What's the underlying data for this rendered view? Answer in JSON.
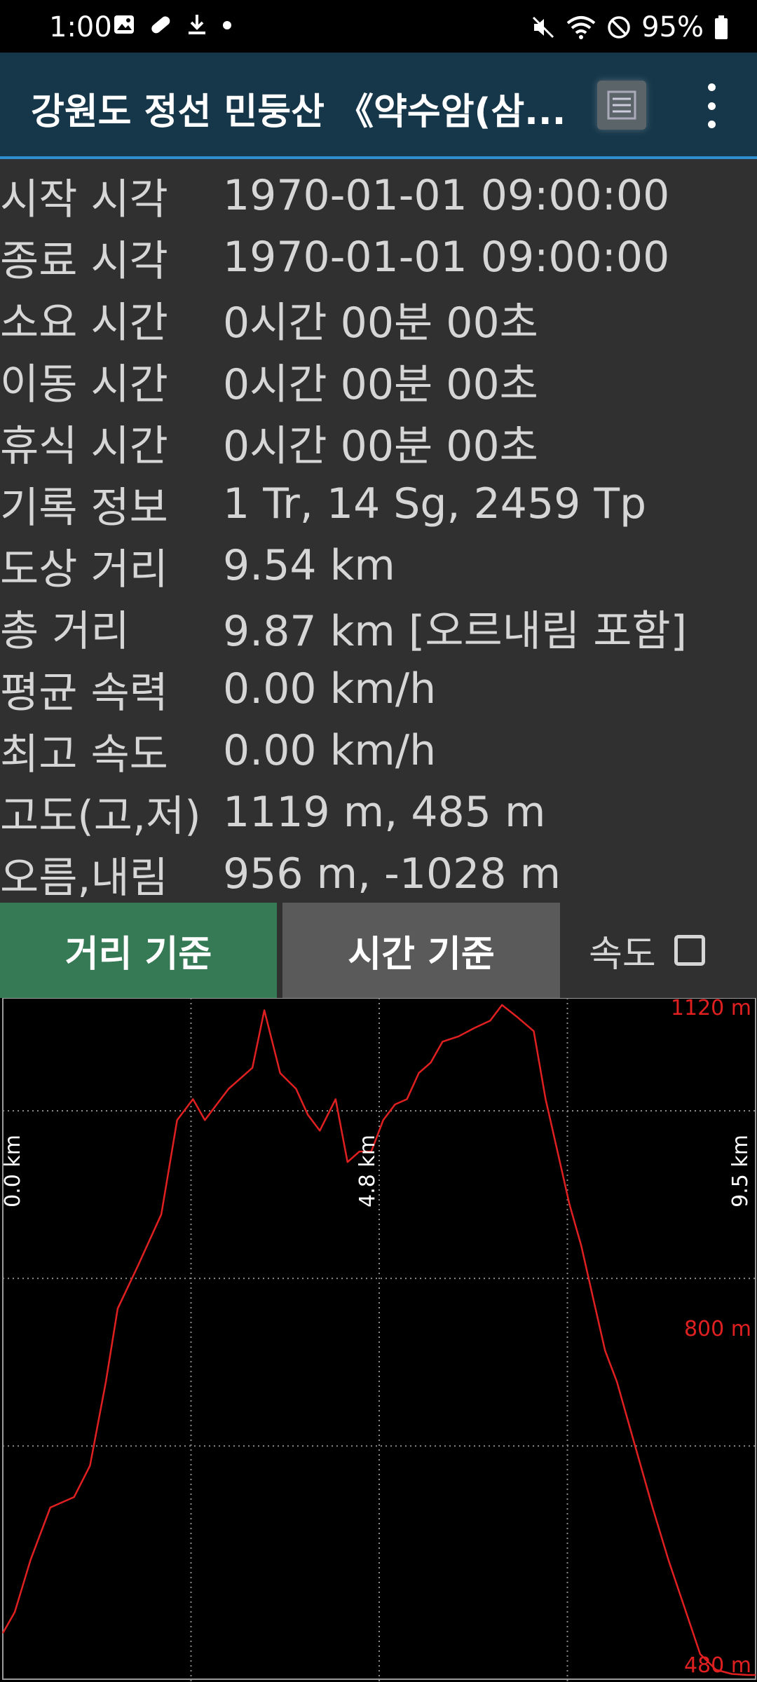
{
  "status_bar": {
    "time": "1:00",
    "battery": "95%",
    "icons": [
      "image-icon",
      "pill-icon",
      "download-icon",
      "dot-icon",
      "mute-icon",
      "wifi-icon",
      "dnd-icon",
      "battery-icon"
    ]
  },
  "app_bar": {
    "title": "강원도 정선 민둥산 《약수암(삼...",
    "list_icon": "list-icon",
    "menu_icon": "more-vert-icon"
  },
  "track_info": [
    {
      "label": "시작 시각",
      "value": "1970-01-01 09:00:00"
    },
    {
      "label": "종료 시각",
      "value": "1970-01-01 09:00:00"
    },
    {
      "label": "소요 시간",
      "value": "0시간 00분 00초"
    },
    {
      "label": "이동 시간",
      "value": "0시간 00분 00초"
    },
    {
      "label": "휴식 시간",
      "value": "0시간 00분 00초"
    },
    {
      "label": "기록 정보",
      "value": "1 Tr, 14 Sg, 2459 Tp"
    },
    {
      "label": "도상 거리",
      "value": "9.54 km"
    },
    {
      "label": "총 거리",
      "value": "9.87 km [오르내림 포함]"
    },
    {
      "label": "평균 속력",
      "value": "0.00 km/h"
    },
    {
      "label": "최고 속도",
      "value": "0.00 km/h"
    },
    {
      "label": "고도(고,저)",
      "value": "1119 m, 485 m"
    },
    {
      "label": "오름,내림",
      "value": "956 m, -1028 m"
    }
  ],
  "buttons": {
    "distance": "거리 기준",
    "time": "시간 기준",
    "speed": "속도"
  },
  "colors": {
    "accent_green": "#357a55",
    "line_red": "#e02020",
    "appbar": "#16374a"
  },
  "chart_data": {
    "type": "line",
    "x_unit": "km",
    "y_unit": "m",
    "xlim": [
      0,
      9.5
    ],
    "ylim": [
      480,
      1120
    ],
    "x_tick_labels": [
      "0.0 km",
      "4.8 km",
      "9.5 km"
    ],
    "y_tick_labels": [
      "1120 m",
      "800 m",
      "480 m"
    ],
    "grid": true,
    "series": [
      {
        "x": [
          0.0,
          0.15,
          0.35,
          0.6,
          0.9,
          1.1,
          1.3,
          1.45,
          1.7,
          2.0,
          2.2,
          2.4,
          2.55,
          2.7,
          2.85,
          3.0,
          3.15,
          3.3,
          3.5,
          3.7,
          3.85,
          4.0,
          4.2,
          4.35,
          4.5,
          4.65,
          4.8,
          4.95,
          5.1,
          5.25,
          5.4,
          5.55,
          5.75,
          5.95,
          6.15,
          6.3,
          6.5,
          6.7,
          6.85,
          7.0,
          7.15,
          7.3,
          7.45,
          7.6,
          7.75,
          7.9,
          8.05,
          8.2,
          8.4,
          8.6,
          8.8,
          9.0,
          9.2,
          9.4,
          9.5
        ],
        "y": [
          520,
          540,
          590,
          640,
          650,
          680,
          760,
          830,
          870,
          920,
          1010,
          1030,
          1010,
          1025,
          1040,
          1050,
          1060,
          1115,
          1055,
          1040,
          1015,
          1000,
          1030,
          970,
          980,
          980,
          1010,
          1025,
          1030,
          1055,
          1065,
          1085,
          1090,
          1098,
          1105,
          1120,
          1108,
          1095,
          1030,
          980,
          930,
          890,
          840,
          790,
          760,
          720,
          680,
          640,
          590,
          545,
          500,
          485,
          481,
          480,
          480
        ]
      }
    ]
  }
}
